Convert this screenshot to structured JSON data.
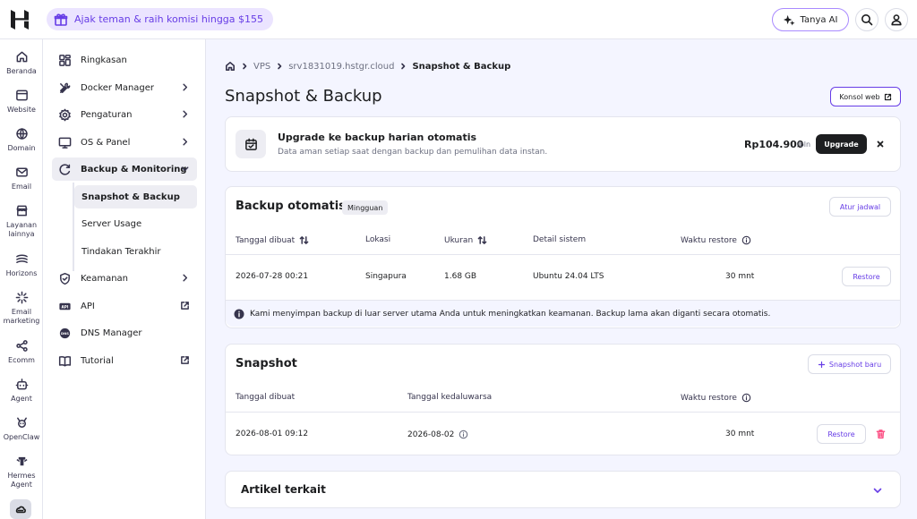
{
  "topbar": {
    "promo": "Ajak teman & raih komisi hingga $155",
    "ai_button": "Tanya AI"
  },
  "rail": [
    {
      "label": "Beranda",
      "icon": "home-icon"
    },
    {
      "label": "Website",
      "icon": "browser-icon"
    },
    {
      "label": "Domain",
      "icon": "globe-icon"
    },
    {
      "label": "Email",
      "icon": "mail-icon"
    },
    {
      "label": "Layanan lainnya",
      "icon": "store-icon"
    },
    {
      "label": "Horizons",
      "icon": "horizons-icon"
    },
    {
      "label": "Email marketing",
      "icon": "sparkle-icon"
    },
    {
      "label": "Ecomm",
      "icon": "share-icon"
    },
    {
      "label": "Agent",
      "icon": "bot-icon"
    },
    {
      "label": "OpenClaw",
      "icon": "claw-icon"
    },
    {
      "label": "Hermes Agent",
      "icon": "hermes-icon"
    }
  ],
  "subnav": {
    "items": [
      {
        "label": "Ringkasan"
      },
      {
        "label": "Docker Manager"
      },
      {
        "label": "Pengaturan"
      },
      {
        "label": "OS & Panel"
      },
      {
        "label": "Backup & Monitoring"
      },
      {
        "label": "Keamanan"
      },
      {
        "label": "API"
      },
      {
        "label": "DNS Manager"
      },
      {
        "label": "Tutorial"
      }
    ],
    "sub_items": [
      "Snapshot & Backup",
      "Server Usage",
      "Tindakan Terakhir"
    ]
  },
  "breadcrumb": [
    "VPS",
    "srv1831019.hstgr.cloud",
    "Snapshot & Backup"
  ],
  "page": {
    "title": "Snapshot & Backup",
    "console_button": "Konsol web"
  },
  "upgrade": {
    "title": "Upgrade ke backup harian otomatis",
    "desc": "Data aman setiap saat dengan backup dan pemulihan data instan.",
    "price": "Rp104.900",
    "period": "/bln",
    "button": "Upgrade"
  },
  "backup": {
    "title": "Backup otomatis",
    "badge": "Mingguan",
    "schedule_button": "Atur jadwal",
    "columns": [
      "Tanggal dibuat",
      "Lokasi",
      "Ukuran",
      "Detail sistem",
      "Waktu restore"
    ],
    "rows": [
      {
        "date": "2026-07-28 00:21",
        "location": "Singapura",
        "size": "1.68 GB",
        "system": "Ubuntu 24.04 LTS",
        "restore_time": "30 mnt",
        "action": "Restore"
      }
    ],
    "note": "Kami menyimpan backup di luar server utama Anda untuk meningkatkan keamanan. Backup lama akan diganti secara otomatis."
  },
  "snapshot": {
    "title": "Snapshot",
    "new_button": "Snapshot baru",
    "columns": [
      "Tanggal dibuat",
      "Tanggal kedaluwarsa",
      "Waktu restore"
    ],
    "rows": [
      {
        "date": "2026-08-01 09:12",
        "expiry": "2026-08-02",
        "restore_time": "30 mnt",
        "action": "Restore"
      }
    ]
  },
  "related": {
    "title": "Artikel terkait"
  }
}
